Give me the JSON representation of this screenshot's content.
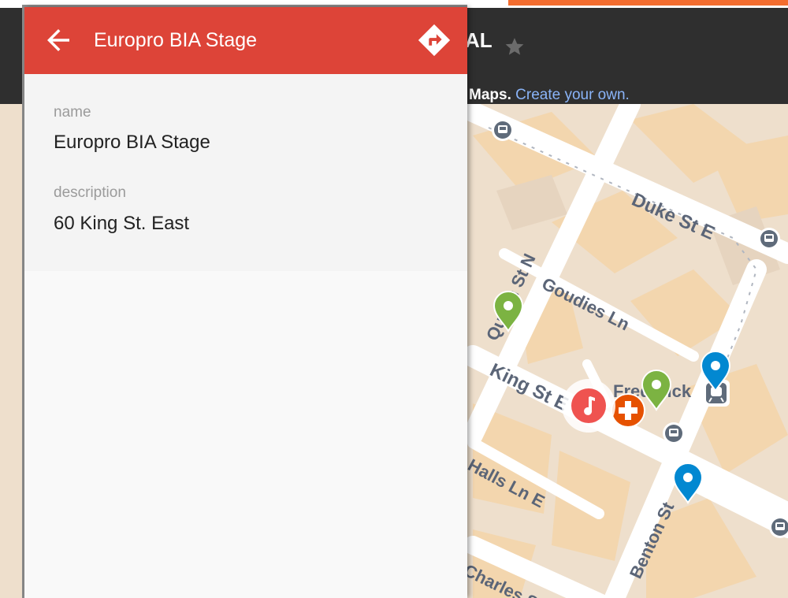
{
  "map": {
    "title": "AL",
    "credit_text": "Maps.",
    "credit_link": "Create your own.",
    "streets": {
      "duke": "Duke St E",
      "queen": "Queen St N",
      "goudies": "Goudies Ln",
      "king": "King St E",
      "frederick": "Frederick",
      "benton": "Benton St",
      "halls": "Halls Ln E",
      "charles": "Charles St"
    },
    "colors": {
      "header_bg": "#2f2f2f",
      "map_block": "#eedfcc",
      "road": "#ffffff",
      "marker_green": "#7cb342",
      "marker_blue": "#0288d1",
      "marker_red": "#ef5350",
      "marker_orange": "#e65100"
    }
  },
  "panel": {
    "title": "Europro BIA Stage",
    "back_icon": "arrow-left-icon",
    "directions_icon": "directions-icon",
    "header_color": "#dd4438",
    "fields": [
      {
        "label": "name",
        "value": "Europro BIA Stage"
      },
      {
        "label": "description",
        "value": "60 King St. East"
      }
    ]
  }
}
